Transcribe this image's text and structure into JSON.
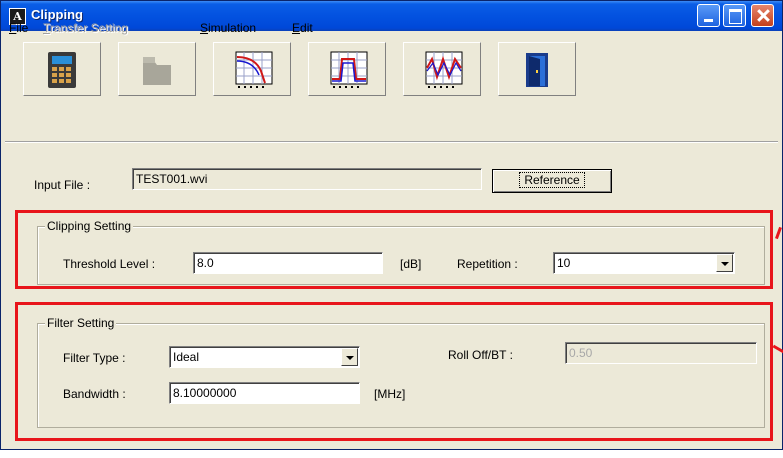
{
  "window": {
    "title": "Clipping"
  },
  "menu": {
    "file": {
      "underline": "F",
      "rest": "ile"
    },
    "transfer": {
      "underline": "T",
      "rest": "ransfer Setting"
    },
    "simulation": {
      "underline": "S",
      "rest": "imulation"
    },
    "edit": {
      "underline": "E",
      "rest": "dit"
    }
  },
  "toolbar": [
    "calculator-icon",
    "folder-icon",
    "filter-response-icon",
    "spectrum-icon",
    "waveform-icon",
    "exit-door-icon"
  ],
  "input_file": {
    "label": "Input File :",
    "value": "TEST001.wvi",
    "reference_label": "Reference"
  },
  "clipping": {
    "group_label": "Clipping Setting",
    "threshold_label": "Threshold Level :",
    "threshold_value": "8.0",
    "threshold_unit": "[dB]",
    "repetition_label": "Repetition :",
    "repetition_value": "10"
  },
  "filter": {
    "group_label": "Filter Setting",
    "type_label": "Filter Type :",
    "type_value": "Ideal",
    "rolloff_label": "Roll Off/BT :",
    "rolloff_value": "0.50",
    "bandwidth_label": "Bandwidth :",
    "bandwidth_value": "8.10000000",
    "bandwidth_unit": "[MHz]"
  },
  "colors": {
    "title_bar": "#0352e0",
    "annotation": "#e8151b",
    "face": "#ece9d8"
  }
}
